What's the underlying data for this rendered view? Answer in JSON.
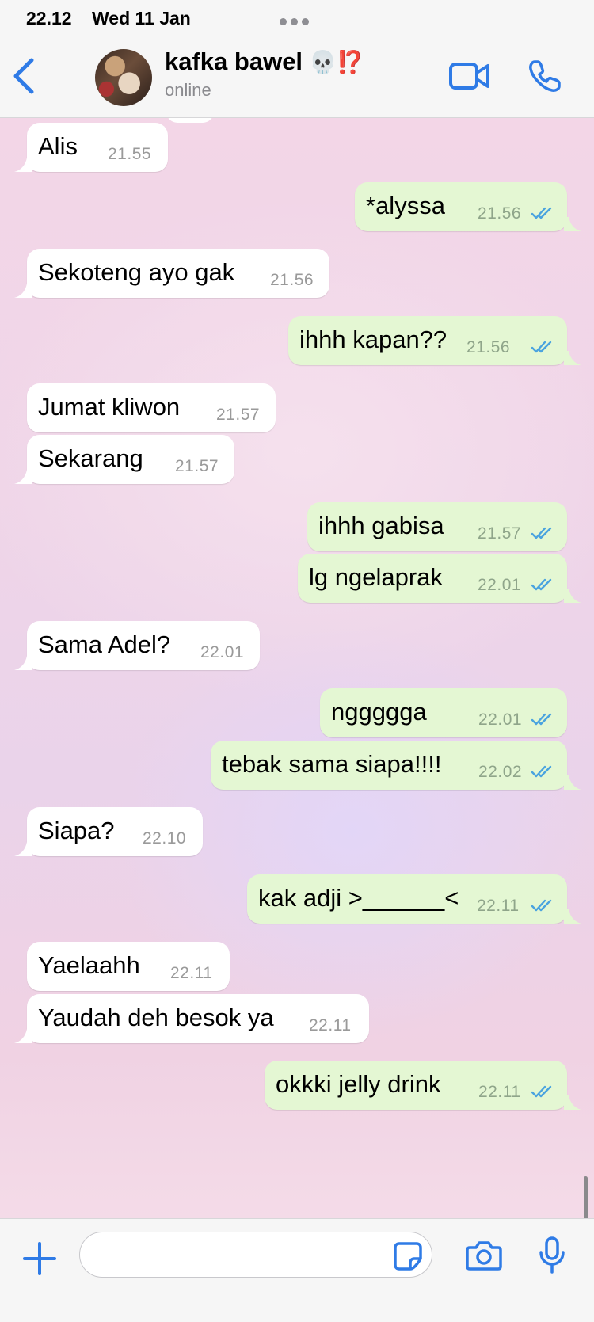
{
  "status_bar": {
    "time": "22.12",
    "date": "Wed 11 Jan"
  },
  "header": {
    "back_icon": "chevron-left-icon",
    "contact_name": "kafka bawel",
    "contact_emoji": "💀⁉️",
    "contact_status": "online",
    "video_icon": "video-camera-icon",
    "call_icon": "phone-icon"
  },
  "colors": {
    "accent": "#2f7be6",
    "outgoing_bubble": "#e4f7d3",
    "incoming_bubble": "#ffffff",
    "read_ticks": "#4aa3df"
  },
  "messages": [
    {
      "dir": "in",
      "text": "Alis",
      "time": "21.55"
    },
    {
      "dir": "out",
      "text": "*alyssa",
      "time": "21.56",
      "status": "read"
    },
    {
      "dir": "in",
      "text": "Sekoteng ayo gak",
      "time": "21.56"
    },
    {
      "dir": "out",
      "text": "ihhh kapan??",
      "time": "21.56",
      "status": "read"
    },
    {
      "dir": "in",
      "text": "Jumat kliwon",
      "time": "21.57"
    },
    {
      "dir": "in",
      "text": "Sekarang",
      "time": "21.57"
    },
    {
      "dir": "out",
      "text": "ihhh gabisa",
      "time": "21.57",
      "status": "read"
    },
    {
      "dir": "out",
      "text": "lg ngelaprak",
      "time": "22.01",
      "status": "read"
    },
    {
      "dir": "in",
      "text": "Sama Adel?",
      "time": "22.01"
    },
    {
      "dir": "out",
      "text": "nggggga",
      "time": "22.01",
      "status": "read"
    },
    {
      "dir": "out",
      "text": "tebak sama siapa!!!!",
      "time": "22.02",
      "status": "read"
    },
    {
      "dir": "in",
      "text": "Siapa?",
      "time": "22.10"
    },
    {
      "dir": "out",
      "text": "kak adji >______<",
      "time": "22.11",
      "status": "read"
    },
    {
      "dir": "in",
      "text": "Yaelaahh",
      "time": "22.11"
    },
    {
      "dir": "in",
      "text": "Yaudah deh besok ya",
      "time": "22.11"
    },
    {
      "dir": "out",
      "text": "okkki jelly drink",
      "time": "22.11",
      "status": "read"
    }
  ],
  "input_bar": {
    "plus_icon": "plus-icon",
    "message_value": "",
    "message_placeholder": "",
    "sticker_icon": "sticker-icon",
    "camera_icon": "camera-icon",
    "mic_icon": "microphone-icon"
  }
}
